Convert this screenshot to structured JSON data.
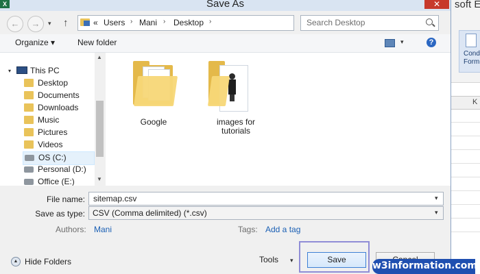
{
  "background_app": {
    "title_fragment": "soft Ex",
    "ribbon_button": "Cond\nForm",
    "column_letter": "K"
  },
  "dialog": {
    "title": "Save As",
    "app_icon": "X",
    "close_glyph": "✕"
  },
  "nav": {
    "back_icon": "←",
    "forward_icon": "→",
    "recent_icon": "▾",
    "up_icon": "↑",
    "address": {
      "prefix": "«",
      "crumbs": [
        "Users",
        "Mani",
        "Desktop"
      ],
      "separator": "›",
      "dropdown_icon": "▾",
      "refresh_icon": "↻"
    },
    "search_placeholder": "Search Desktop"
  },
  "toolbar": {
    "organize_label": "Organize ▾",
    "new_folder_label": "New folder",
    "view_drop": "▾",
    "help": "?"
  },
  "tree": {
    "root": {
      "label": "This PC",
      "expander": "▾"
    },
    "items": [
      {
        "label": "Desktop",
        "icon": "desktop-folder-icon"
      },
      {
        "label": "Documents",
        "icon": "documents-folder-icon"
      },
      {
        "label": "Downloads",
        "icon": "downloads-folder-icon"
      },
      {
        "label": "Music",
        "icon": "music-folder-icon"
      },
      {
        "label": "Pictures",
        "icon": "pictures-folder-icon"
      },
      {
        "label": "Videos",
        "icon": "videos-folder-icon"
      },
      {
        "label": "OS (C:)",
        "icon": "drive-icon",
        "selected": true
      },
      {
        "label": "Personal (D:)",
        "icon": "drive-icon"
      },
      {
        "label": "Office (E:)",
        "icon": "drive-icon"
      }
    ],
    "scroll_up": "▲",
    "scroll_down": "▼"
  },
  "files": [
    {
      "label": "Google"
    },
    {
      "label": "images for\ntutorials"
    }
  ],
  "form": {
    "file_name_label": "File name:",
    "file_name_value": "sitemap.csv",
    "save_type_label": "Save as type:",
    "save_type_value": "CSV (Comma delimited) (*.csv)",
    "authors_label": "Authors:",
    "authors_value": "Mani",
    "tags_label": "Tags:",
    "tags_value": "Add a tag",
    "drop_icon": "▾"
  },
  "footer": {
    "hide_folders_label": "Hide Folders",
    "hide_folders_icon": "▲",
    "tools_label": "Tools",
    "tools_drop": "▾",
    "save_label": "Save",
    "cancel_label": "Cancel"
  },
  "watermark": "w3information.com"
}
